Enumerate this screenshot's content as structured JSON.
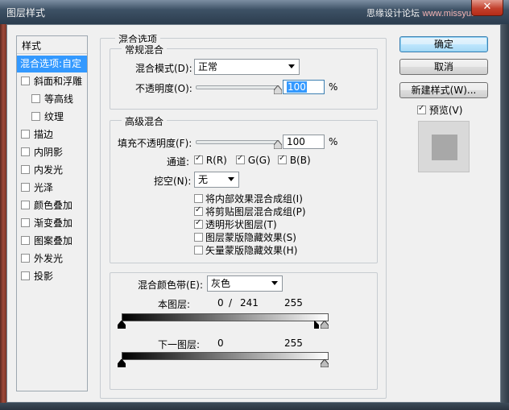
{
  "window": {
    "title": "图层样式",
    "watermark_text": "思缘设计论坛",
    "watermark_url": "www.missyuan.com",
    "close_glyph": "✕"
  },
  "styles": {
    "header": "样式",
    "selected_label": "混合选项:自定",
    "items": [
      {
        "label": "斜面和浮雕",
        "checked": false
      },
      {
        "label": "等高线",
        "checked": false,
        "indent": true
      },
      {
        "label": "纹理",
        "checked": false,
        "indent": true
      },
      {
        "label": "描边",
        "checked": false
      },
      {
        "label": "内阴影",
        "checked": false
      },
      {
        "label": "内发光",
        "checked": false
      },
      {
        "label": "光泽",
        "checked": false
      },
      {
        "label": "颜色叠加",
        "checked": false
      },
      {
        "label": "渐变叠加",
        "checked": false
      },
      {
        "label": "图案叠加",
        "checked": false
      },
      {
        "label": "外发光",
        "checked": false
      },
      {
        "label": "投影",
        "checked": false
      }
    ]
  },
  "blend_options": {
    "title": "混合选项",
    "general": {
      "title": "常规混合",
      "mode_label": "混合模式(D):",
      "mode_value": "正常",
      "opacity_label": "不透明度(O):",
      "opacity_value": "100",
      "opacity_unit": "%",
      "opacity_level": 100
    },
    "advanced": {
      "title": "高级混合",
      "fill_label": "填充不透明度(F):",
      "fill_value": "100",
      "fill_unit": "%",
      "fill_level": 100,
      "channels_label": "通道:",
      "channel_r": "R(R)",
      "channel_g": "G(G)",
      "channel_b": "B(B)",
      "knockout_label": "挖空(N):",
      "knockout_value": "无",
      "options": [
        {
          "label": "将内部效果混合成组(I)",
          "checked": false
        },
        {
          "label": "将剪贴图层混合成组(P)",
          "checked": true
        },
        {
          "label": "透明形状图层(T)",
          "checked": true
        },
        {
          "label": "图层蒙版隐藏效果(S)",
          "checked": false
        },
        {
          "label": "矢量蒙版隐藏效果(H)",
          "checked": false
        }
      ]
    },
    "blend_if": {
      "label": "混合颜色带(E):",
      "value": "灰色",
      "this_layer_label": "本图层:",
      "this_layer_min": "0",
      "this_layer_sep": "/",
      "this_layer_split": "241",
      "this_layer_max": "255",
      "underlying_label": "下一图层:",
      "underlying_min": "0",
      "underlying_max": "255"
    }
  },
  "buttons": {
    "ok": "确定",
    "cancel": "取消",
    "new_style": "新建样式(W)...",
    "preview_label": "预览(V)",
    "preview_checked": true
  }
}
